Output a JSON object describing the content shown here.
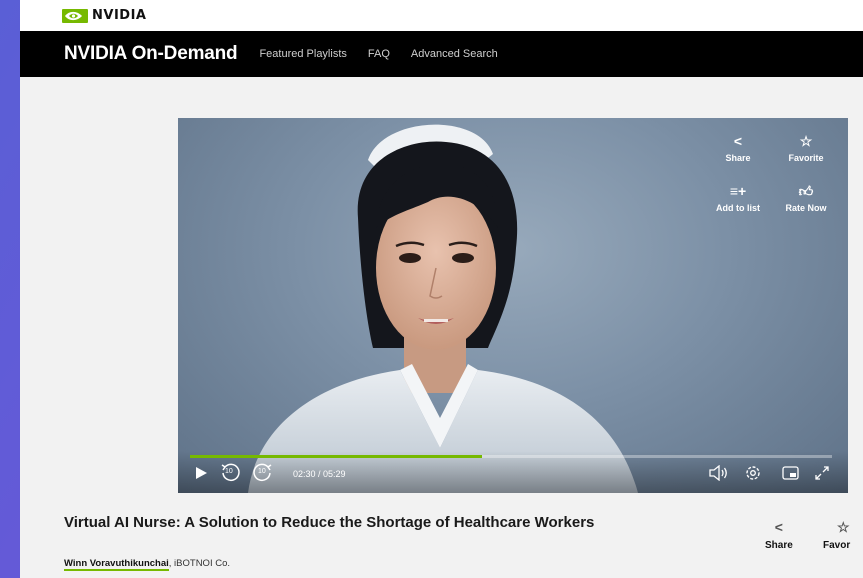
{
  "brand": {
    "logo_text": "NVIDIA",
    "accent": "#76b900"
  },
  "nav": {
    "site_title": "NVIDIA On-Demand",
    "links": [
      "Featured Playlists",
      "FAQ",
      "Advanced Search"
    ]
  },
  "video": {
    "actions": {
      "share": "Share",
      "favorite": "Favorite",
      "add_to_list": "Add to list",
      "rate_now": "Rate Now"
    },
    "time_display": "02:30 / 05:29",
    "progress_fraction": 0.455,
    "skip_back_seconds": "10",
    "skip_forward_seconds": "10",
    "icons": [
      "play-icon",
      "rewind-10-icon",
      "forward-10-icon",
      "volume-icon",
      "settings-icon",
      "picture-in-picture-icon",
      "fullscreen-icon"
    ]
  },
  "session": {
    "title": "Virtual AI Nurse: A Solution to Reduce the Shortage of Healthcare Workers",
    "author": "Winn Voravuthikunchai",
    "org": ", iBOTNOI Co.",
    "share_label": "Share",
    "favorite_label": "Favor"
  }
}
